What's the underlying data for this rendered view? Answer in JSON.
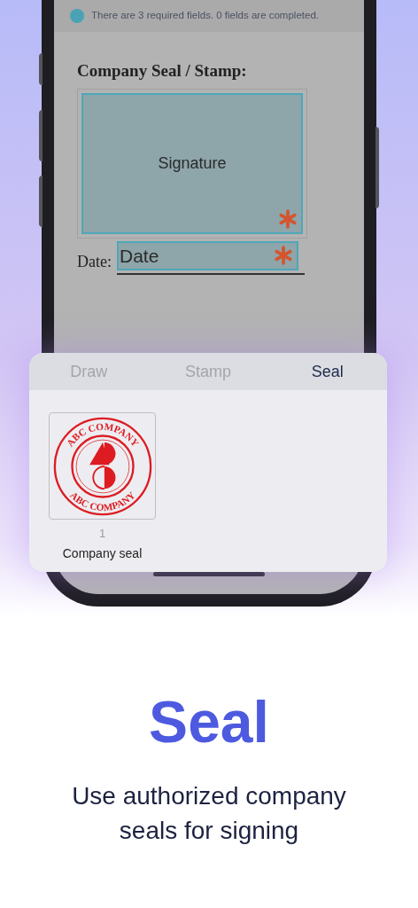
{
  "document": {
    "status_message": "There are 3 required fields. 0 fields are completed.",
    "section_heading": "Company Seal / Stamp:",
    "signature_field": {
      "placeholder": "Signature",
      "required": true
    },
    "date_label": "Date:",
    "date_field": {
      "placeholder": "Date",
      "required": true
    }
  },
  "panel": {
    "tabs": [
      {
        "label": "Draw",
        "selected": false
      },
      {
        "label": "Stamp",
        "selected": false
      },
      {
        "label": "Seal",
        "selected": true
      }
    ],
    "seals": [
      {
        "seal_text": [
          "ABC COMPANY",
          "ABC COMPANY"
        ],
        "number": "1",
        "name": "Company seal"
      }
    ]
  },
  "headline": "Seal",
  "subtitle": "Use authorized company seals for signing"
}
